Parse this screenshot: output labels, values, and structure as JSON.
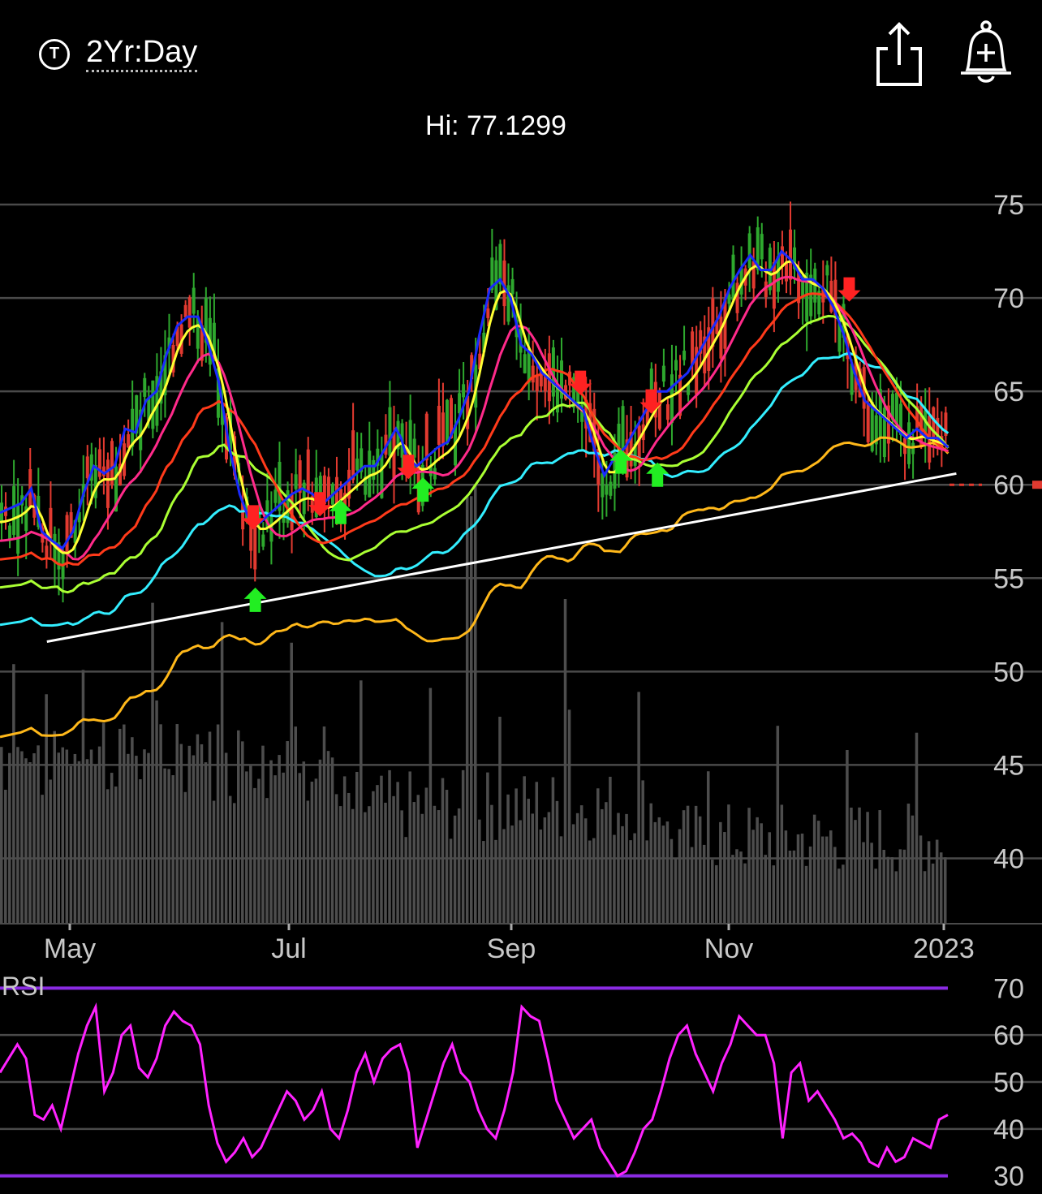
{
  "header": {
    "timeframe_icon": "T",
    "timeframe_label": "2Yr:Day",
    "share_icon": "share-icon",
    "alert_icon": "bell-plus-icon"
  },
  "colors": {
    "background": "#000000",
    "grid": "#4a4a4a",
    "axis_text": "#c8c8c8",
    "up_candle": "#2ea82e",
    "down_candle": "#e23a30",
    "volume": "#4d4d4d",
    "rsi_line": "#ff22ff",
    "rsi_band": "#8a2be2",
    "trendline": "#ffffff",
    "signal_up": "#22ee22",
    "signal_down": "#ff2222"
  },
  "chart_data": [
    {
      "type": "candlestick",
      "hi_label": "Hi: 77.1299",
      "ylim": [
        36.5,
        79
      ],
      "y_ticks": [
        75,
        70,
        65,
        60,
        55,
        50,
        45,
        40
      ],
      "x_ticks": [
        "May",
        "Jul",
        "Sep",
        "Nov",
        "2023"
      ],
      "last_price": 60,
      "trendline": [
        {
          "x": 0.045,
          "y": 51.6
        },
        {
          "x": 0.91,
          "y": 60.6
        }
      ],
      "price_path": [
        [
          0.0,
          58.5
        ],
        [
          0.02,
          59.0
        ],
        [
          0.03,
          59.8
        ],
        [
          0.04,
          57.5
        ],
        [
          0.05,
          57.0
        ],
        [
          0.06,
          56.6
        ],
        [
          0.07,
          57.5
        ],
        [
          0.08,
          59.5
        ],
        [
          0.09,
          61.0
        ],
        [
          0.1,
          60.6
        ],
        [
          0.11,
          61.0
        ],
        [
          0.12,
          63.0
        ],
        [
          0.13,
          62.8
        ],
        [
          0.14,
          64.5
        ],
        [
          0.15,
          65.0
        ],
        [
          0.16,
          67.0
        ],
        [
          0.17,
          68.5
        ],
        [
          0.18,
          69.0
        ],
        [
          0.19,
          69.0
        ],
        [
          0.2,
          67.5
        ],
        [
          0.21,
          65.5
        ],
        [
          0.22,
          62.0
        ],
        [
          0.23,
          59.5
        ],
        [
          0.24,
          58.0
        ],
        [
          0.245,
          58.0
        ],
        [
          0.25,
          58.0
        ],
        [
          0.26,
          58.5
        ],
        [
          0.27,
          59.0
        ],
        [
          0.28,
          59.5
        ],
        [
          0.29,
          59.8
        ],
        [
          0.3,
          59.5
        ],
        [
          0.31,
          59.0
        ],
        [
          0.32,
          59.5
        ],
        [
          0.33,
          60.0
        ],
        [
          0.34,
          60.5
        ],
        [
          0.35,
          61.0
        ],
        [
          0.36,
          61.0
        ],
        [
          0.37,
          62.0
        ],
        [
          0.38,
          63.0
        ],
        [
          0.385,
          62.5
        ],
        [
          0.39,
          61.5
        ],
        [
          0.4,
          61.0
        ],
        [
          0.41,
          61.5
        ],
        [
          0.42,
          62.0
        ],
        [
          0.43,
          62.3
        ],
        [
          0.44,
          63.5
        ],
        [
          0.45,
          65.0
        ],
        [
          0.46,
          68.0
        ],
        [
          0.47,
          70.5
        ],
        [
          0.48,
          71.0
        ],
        [
          0.49,
          70.0
        ],
        [
          0.5,
          67.5
        ],
        [
          0.51,
          67.0
        ],
        [
          0.52,
          66.0
        ],
        [
          0.53,
          65.5
        ],
        [
          0.54,
          65.0
        ],
        [
          0.55,
          64.5
        ],
        [
          0.56,
          64.0
        ],
        [
          0.57,
          62.0
        ],
        [
          0.58,
          60.5
        ],
        [
          0.59,
          61.5
        ],
        [
          0.6,
          62.0
        ],
        [
          0.61,
          63.0
        ],
        [
          0.62,
          64.0
        ],
        [
          0.63,
          65.0
        ],
        [
          0.64,
          65.0
        ],
        [
          0.65,
          65.5
        ],
        [
          0.66,
          66.0
        ],
        [
          0.67,
          67.0
        ],
        [
          0.68,
          68.0
        ],
        [
          0.69,
          69.0
        ],
        [
          0.7,
          70.5
        ],
        [
          0.71,
          71.5
        ],
        [
          0.72,
          72.3
        ],
        [
          0.73,
          71.5
        ],
        [
          0.74,
          71.5
        ],
        [
          0.75,
          72.5
        ],
        [
          0.76,
          72.0
        ],
        [
          0.77,
          71.0
        ],
        [
          0.78,
          71.0
        ],
        [
          0.79,
          70.5
        ],
        [
          0.8,
          69.5
        ],
        [
          0.81,
          68.0
        ],
        [
          0.82,
          66.0
        ],
        [
          0.83,
          64.5
        ],
        [
          0.84,
          64.0
        ],
        [
          0.85,
          63.5
        ],
        [
          0.86,
          63.0
        ],
        [
          0.87,
          62.5
        ],
        [
          0.88,
          63.0
        ],
        [
          0.89,
          62.5
        ],
        [
          0.9,
          62.5
        ],
        [
          0.91,
          62.0
        ]
      ],
      "moving_averages": [
        {
          "color": "#1a2aff",
          "smoothing": 0,
          "offset": 0
        },
        {
          "color": "#ffff33",
          "smoothing": 1,
          "offset": -0.5
        },
        {
          "color": "#ff2a8a",
          "smoothing": 3,
          "offset": -1.5
        },
        {
          "color": "#ff3a1a",
          "smoothing": 6,
          "offset": -2.5
        },
        {
          "color": "#aaff33",
          "smoothing": 8,
          "offset": -4
        },
        {
          "color": "#33eeff",
          "smoothing": 11,
          "offset": -6
        },
        {
          "color": "#ffb81a",
          "smoothing": 16,
          "offset": -12
        }
      ],
      "signals": [
        {
          "x": 0.245,
          "y": 53.8,
          "dir": "up"
        },
        {
          "x": 0.243,
          "y": 58.3,
          "dir": "down"
        },
        {
          "x": 0.307,
          "y": 59.0,
          "dir": "down"
        },
        {
          "x": 0.327,
          "y": 58.5,
          "dir": "up"
        },
        {
          "x": 0.392,
          "y": 61.0,
          "dir": "down"
        },
        {
          "x": 0.406,
          "y": 59.7,
          "dir": "up"
        },
        {
          "x": 0.557,
          "y": 65.5,
          "dir": "down"
        },
        {
          "x": 0.596,
          "y": 61.2,
          "dir": "up"
        },
        {
          "x": 0.625,
          "y": 64.5,
          "dir": "down"
        },
        {
          "x": 0.631,
          "y": 60.5,
          "dir": "up"
        },
        {
          "x": 0.815,
          "y": 70.5,
          "dir": "down"
        }
      ]
    },
    {
      "type": "line",
      "title": "RSI",
      "ylim": [
        27,
        73
      ],
      "y_ticks": [
        70,
        60,
        50,
        40,
        30
      ],
      "band_values": [
        70,
        30
      ],
      "values": [
        52,
        55,
        58,
        55,
        43,
        42,
        45,
        40,
        48,
        56,
        62,
        66,
        48,
        52,
        60,
        62,
        53,
        51,
        55,
        62,
        65,
        63,
        62,
        58,
        45,
        37,
        33,
        35,
        38,
        34,
        36,
        40,
        44,
        48,
        46,
        42,
        44,
        48,
        40,
        38,
        44,
        52,
        56,
        50,
        55,
        57,
        58,
        52,
        36,
        42,
        48,
        54,
        58,
        52,
        50,
        44,
        40,
        38,
        44,
        52,
        66,
        64,
        63,
        55,
        46,
        42,
        38,
        40,
        42,
        36,
        33,
        30,
        31,
        35,
        40,
        42,
        48,
        55,
        60,
        62,
        56,
        52,
        48,
        54,
        58,
        64,
        62,
        60,
        60,
        54,
        38,
        52,
        54,
        46,
        48,
        45,
        42,
        38,
        39,
        37,
        33,
        32,
        36,
        33,
        34,
        38,
        37,
        36,
        42,
        43
      ]
    }
  ]
}
